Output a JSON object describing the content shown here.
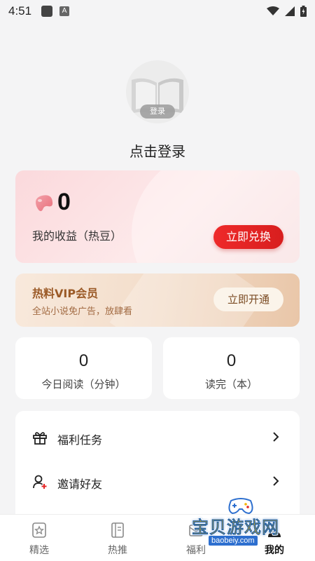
{
  "status_bar": {
    "time": "4:51",
    "app_badge": "A"
  },
  "profile": {
    "login_badge": "登录",
    "login_prompt": "点击登录"
  },
  "earnings": {
    "value": "0",
    "label": "我的收益（热豆）",
    "redeem_button": "立即兑换"
  },
  "vip": {
    "title": "热料VIP会员",
    "subtitle": "全站小说免广告，放肆看",
    "open_button": "立即开通"
  },
  "stats": [
    {
      "value": "0",
      "label": "今日阅读（分钟）"
    },
    {
      "value": "0",
      "label": "读完（本）"
    }
  ],
  "menu": [
    {
      "label": "福利任务",
      "icon": "gift-icon"
    },
    {
      "label": "邀请好友",
      "icon": "invite-user-icon"
    }
  ],
  "bottom_nav": [
    {
      "label": "精选",
      "icon": "star-badge-icon",
      "active": false
    },
    {
      "label": "热推",
      "icon": "book-icon",
      "active": false
    },
    {
      "label": "福利",
      "icon": "envelope-icon",
      "active": false
    },
    {
      "label": "我的",
      "icon": "profile-icon",
      "active": true
    }
  ],
  "watermark": {
    "title": "宝贝游戏网",
    "url": "baobeiy.com"
  },
  "colors": {
    "accent_red": "#e52626",
    "vip_brown": "#9b5a27",
    "background": "#f4f4f5"
  }
}
